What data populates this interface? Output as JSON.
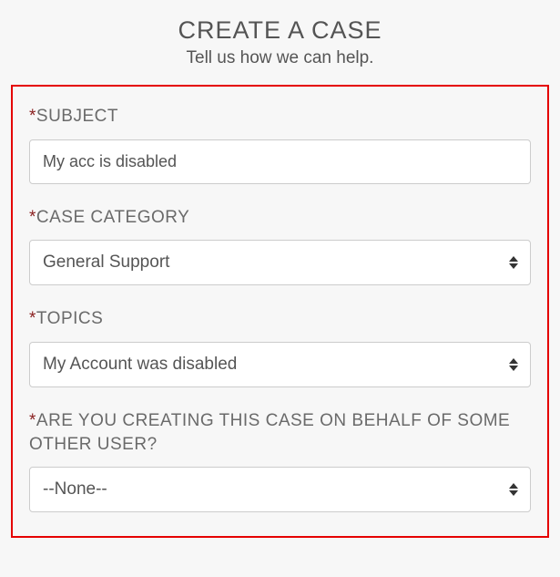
{
  "header": {
    "title": "CREATE A CASE",
    "subtitle": "Tell us how we can help."
  },
  "form": {
    "subject": {
      "label": "SUBJECT",
      "value": "My acc is disabled"
    },
    "category": {
      "label": "CASE CATEGORY",
      "selected": "General Support"
    },
    "topics": {
      "label": "TOPICS",
      "selected": "My Account was disabled"
    },
    "onBehalf": {
      "label": "ARE YOU CREATING THIS CASE ON BEHALF OF SOME OTHER USER?",
      "selected": "--None--"
    }
  }
}
